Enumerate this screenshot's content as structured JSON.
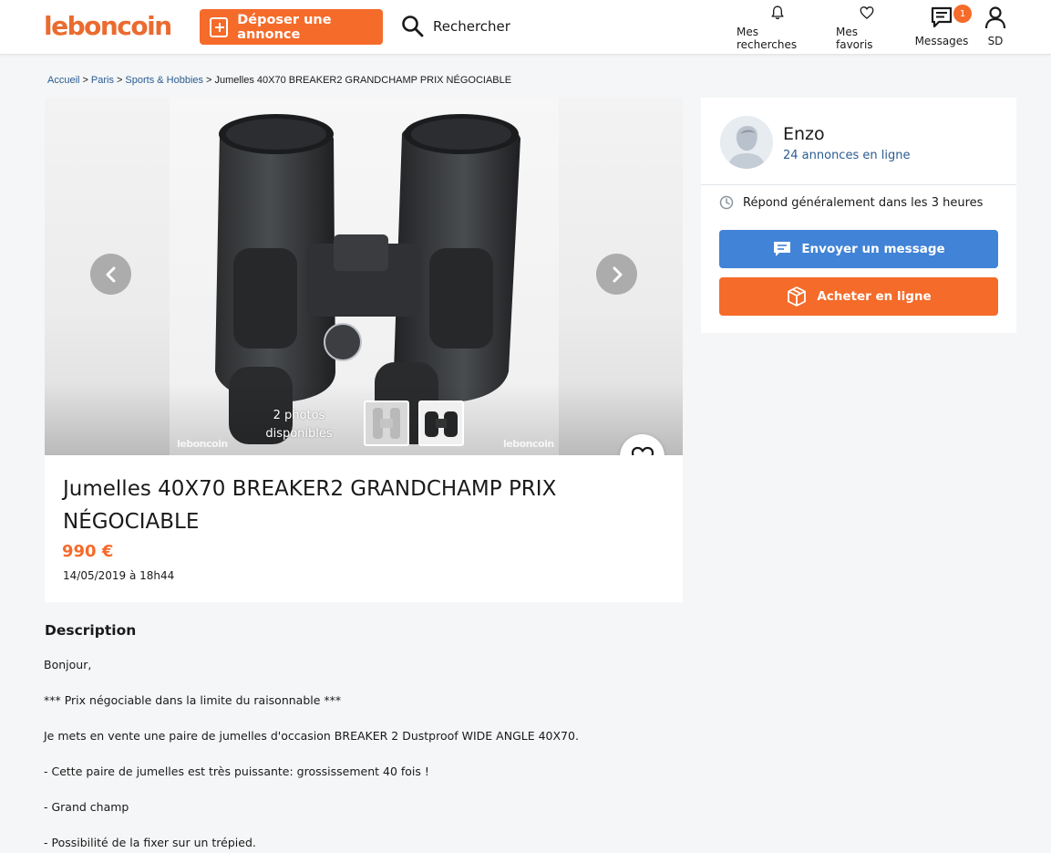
{
  "header": {
    "logo": "leboncoin",
    "post_button": "Déposer une annonce",
    "search": "Rechercher",
    "nav": {
      "searches": "Mes recherches",
      "favorites": "Mes favoris",
      "messages": "Messages",
      "messages_badge": "1",
      "account": "SD"
    }
  },
  "breadcrumb": {
    "items": [
      "Accueil",
      "Paris",
      "Sports & Hobbies"
    ],
    "separator": ">",
    "current": "Jumelles 40X70 BREAKER2 GRANDCHAMP PRIX NÉGOCIABLE"
  },
  "gallery": {
    "photos_count_line1": "2 photos",
    "photos_count_line2": "disponibles",
    "watermark": "leboncoin"
  },
  "ad": {
    "title": "Jumelles 40X70 BREAKER2 GRANDCHAMP PRIX NÉGOCIABLE",
    "price": "990 €",
    "date": "14/05/2019 à 18h44"
  },
  "description": {
    "heading": "Description",
    "lines": [
      "Bonjour,",
      "*** Prix négociable dans la limite du raisonnable ***",
      "Je mets en vente une paire de jumelles d'occasion BREAKER 2 Dustproof WIDE ANGLE 40X70.",
      "- Cette paire de jumelles est très puissante: grossissement 40 fois !",
      "- Grand champ",
      "- Possibilité de la fixer sur un trépied."
    ]
  },
  "seller": {
    "name": "Enzo",
    "listings": "24 annonces en ligne",
    "reply_time": "Répond généralement dans les 3 heures",
    "message_button": "Envoyer un message",
    "buy_button": "Acheter en ligne"
  },
  "colors": {
    "brand_orange": "#f56b2a",
    "link_blue": "#2a5c91",
    "message_blue": "#4183d7"
  }
}
